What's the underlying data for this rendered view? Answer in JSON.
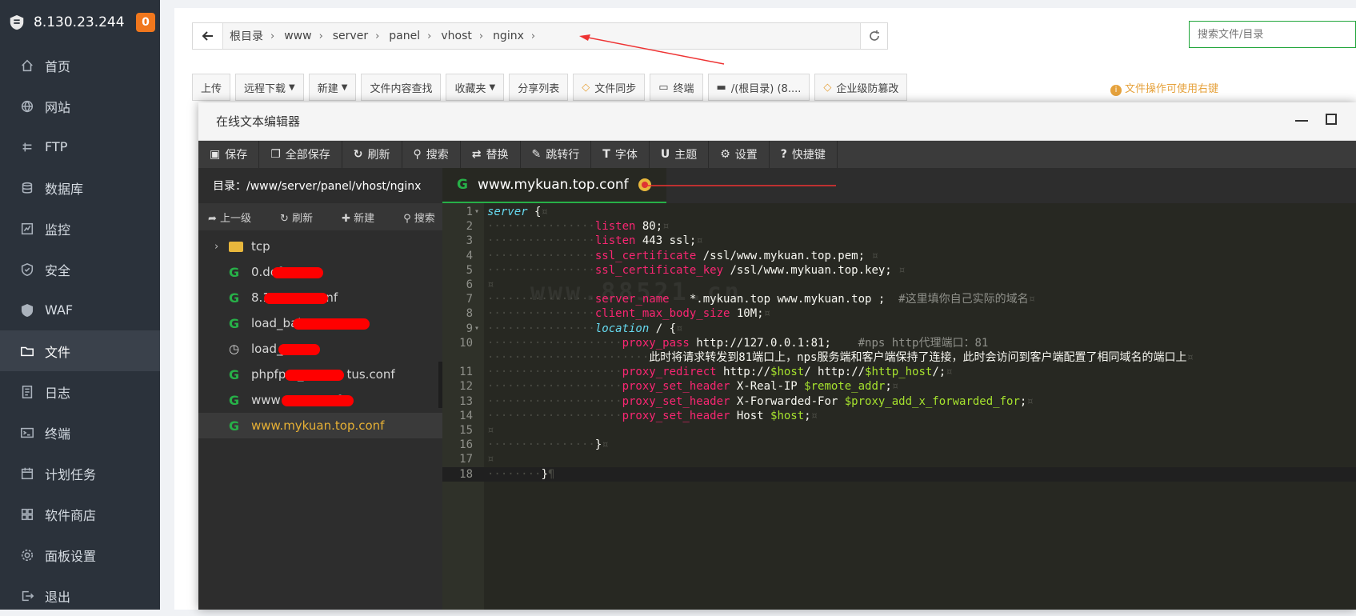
{
  "sidebar": {
    "ip": "8.130.23.244",
    "badge": "0",
    "items": [
      {
        "label": "首页",
        "icon": "home-icon"
      },
      {
        "label": "网站",
        "icon": "globe-icon"
      },
      {
        "label": "FTP",
        "icon": "ftp-icon"
      },
      {
        "label": "数据库",
        "icon": "database-icon"
      },
      {
        "label": "监控",
        "icon": "monitor-icon"
      },
      {
        "label": "安全",
        "icon": "shield-icon"
      },
      {
        "label": "WAF",
        "icon": "waf-icon"
      },
      {
        "label": "文件",
        "icon": "folder-icon",
        "active": true
      },
      {
        "label": "日志",
        "icon": "log-icon"
      },
      {
        "label": "终端",
        "icon": "terminal-icon"
      },
      {
        "label": "计划任务",
        "icon": "calendar-icon"
      },
      {
        "label": "软件商店",
        "icon": "grid-icon"
      },
      {
        "label": "面板设置",
        "icon": "gear-icon"
      },
      {
        "label": "退出",
        "icon": "logout-icon"
      }
    ]
  },
  "pathbar": {
    "segments": [
      "根目录",
      "www",
      "server",
      "panel",
      "vhost",
      "nginx"
    ]
  },
  "search": {
    "placeholder": "搜索文件/目录"
  },
  "toolbar": {
    "upload": "上传",
    "remote_download": "远程下载",
    "new": "新建",
    "content_search": "文件内容查找",
    "favorites": "收藏夹",
    "share_list": "分享列表",
    "file_sync": "文件同步",
    "terminal": "终端",
    "root_dir": "/(根目录) (8....",
    "tamper_proof": "企业级防篡改"
  },
  "hint": "文件操作可使用右键",
  "editor": {
    "title": "在线文本编辑器",
    "buttons": {
      "save": "保存",
      "save_all": "全部保存",
      "refresh": "刷新",
      "search": "搜索",
      "replace": "替换",
      "goto_line": "跳转行",
      "font": "字体",
      "theme": "主题",
      "settings": "设置",
      "shortcuts": "快捷键"
    },
    "dir_label": "目录：/www/server/panel/vhost/nginx",
    "tree_ops": {
      "up": "上一级",
      "refresh": "刷新",
      "new": "新建",
      "search": "搜索"
    },
    "files": [
      {
        "name": "tcp",
        "type": "folder"
      },
      {
        "name": "0.def",
        "type": "conf"
      },
      {
        "name": "8.13",
        "type": "conf",
        "tail": "nf"
      },
      {
        "name": "load_bala",
        "type": "conf"
      },
      {
        "name": "load_t",
        "type": "timer"
      },
      {
        "name": "phpfpm_",
        "type": "conf",
        "tail": "tus.conf"
      },
      {
        "name": "www",
        "type": "conf",
        "tail": "f"
      },
      {
        "name": "www.mykuan.top.conf",
        "type": "conf",
        "selected": true
      }
    ],
    "tab": "www.mykuan.top.conf",
    "watermark": "www.88521.cn",
    "code": [
      {
        "n": "1",
        "fold": true,
        "t": "server {¤"
      },
      {
        "n": "2",
        "t": "                listen 80;¤"
      },
      {
        "n": "3",
        "t": "                listen 443 ssl;¤"
      },
      {
        "n": "4",
        "t": "                ssl_certificate /ssl/www.mykuan.top.pem; ¤"
      },
      {
        "n": "5",
        "t": "                ssl_certificate_key /ssl/www.mykuan.top.key; ¤"
      },
      {
        "n": "6",
        "t": "¤"
      },
      {
        "n": "7",
        "t": "                server_name   *.mykuan.top www.mykuan.top ;  #这里填你自己实际的域名¤"
      },
      {
        "n": "8",
        "t": "                client_max_body_size 10M;¤"
      },
      {
        "n": "9",
        "fold": true,
        "t": "                location / {¤"
      },
      {
        "n": "10",
        "t": "                    proxy_pass http://127.0.0.1:81;    #nps http代理端口：81"
      },
      {
        "n": "",
        "t": "                        此时将请求转发到81端口上，nps服务端和客户端保持了连接，此时会访问到客户端配置了相同域名的端口上¤"
      },
      {
        "n": "11",
        "t": "                    proxy_redirect http://$host/ http://$http_host/;¤"
      },
      {
        "n": "12",
        "t": "                    proxy_set_header X-Real-IP $remote_addr;¤"
      },
      {
        "n": "13",
        "t": "                    proxy_set_header X-Forwarded-For $proxy_add_x_forwarded_for;¤"
      },
      {
        "n": "14",
        "t": "                    proxy_set_header Host $host;¤"
      },
      {
        "n": "15",
        "t": "¤"
      },
      {
        "n": "16",
        "t": "                }¤"
      },
      {
        "n": "17",
        "t": "¤"
      },
      {
        "n": "18",
        "t": "        }¶"
      }
    ]
  }
}
